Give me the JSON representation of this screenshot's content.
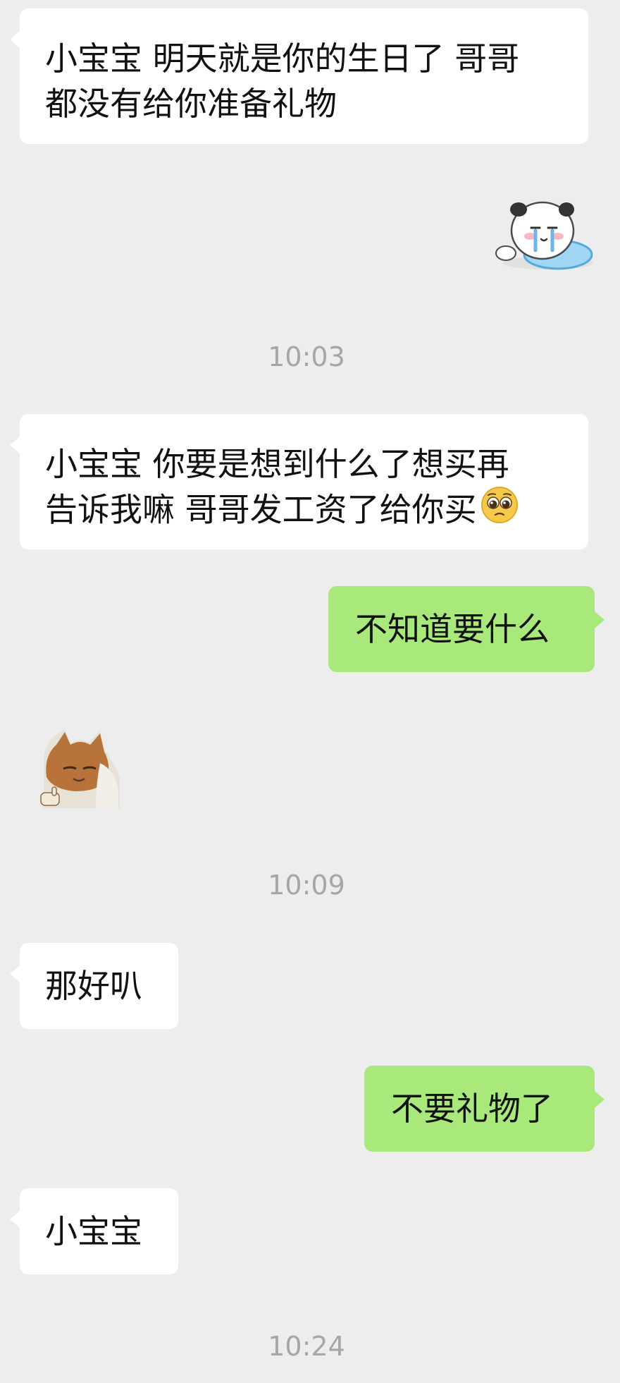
{
  "messages": [
    {
      "side": "in",
      "lines": [
        "小宝宝 明天就是你的生日了 哥哥",
        "都没有给你准备礼物"
      ]
    },
    {
      "side": "out",
      "sticker": "crying-panda-sticker"
    },
    {
      "time": "10:03"
    },
    {
      "side": "in",
      "lines": [
        "小宝宝 你要是想到什么了想买再",
        "告诉我嘛 哥哥发工资了给你买"
      ],
      "emoji": "pleading-face-emoji"
    },
    {
      "side": "out",
      "lines": [
        "不知道要什么"
      ]
    },
    {
      "side": "in",
      "sticker": "cat-pointing-sticker"
    },
    {
      "time": "10:09"
    },
    {
      "side": "in",
      "lines": [
        "那好叭"
      ]
    },
    {
      "side": "out",
      "lines": [
        "不要礼物了"
      ]
    },
    {
      "side": "in",
      "lines": [
        "小宝宝"
      ]
    },
    {
      "time": "10:24"
    }
  ],
  "colors": {
    "background": "#ededed",
    "incoming_bubble": "#ffffff",
    "outgoing_bubble": "#a9e97c",
    "timestamp": "#a6a6a6"
  }
}
